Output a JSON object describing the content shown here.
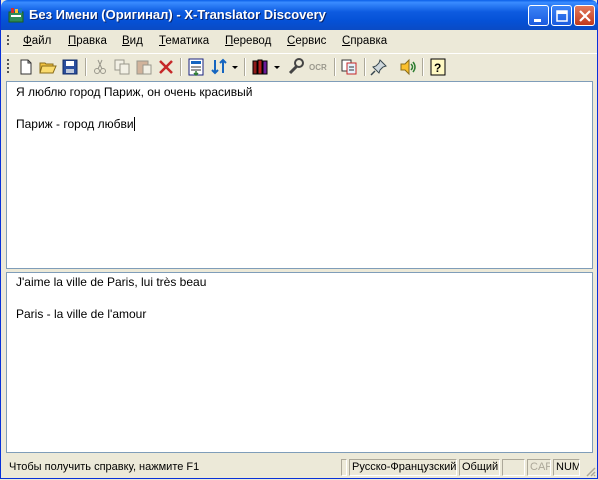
{
  "window": {
    "title": "Без Имени (Оригинал) - X-Translator Discovery",
    "icon": "app-logo-icon",
    "controls": [
      "minimize-icon",
      "maximize-icon",
      "close-icon"
    ]
  },
  "menu": {
    "items": [
      {
        "label": "Файл",
        "mnemonic": "Ф"
      },
      {
        "label": "Правка",
        "mnemonic": "П"
      },
      {
        "label": "Вид",
        "mnemonic": "В"
      },
      {
        "label": "Тематика",
        "mnemonic": "Т"
      },
      {
        "label": "Перевод",
        "mnemonic": "П"
      },
      {
        "label": "Сервис",
        "mnemonic": "С"
      },
      {
        "label": "Справка",
        "mnemonic": "С"
      }
    ]
  },
  "toolbar": {
    "tools": [
      "new-document-icon",
      "open-folder-icon",
      "save-icon",
      "cut-icon",
      "copy-icon",
      "paste-icon",
      "delete-icon",
      "translate-icon",
      "direction-icon",
      "dictionary-icon",
      "settings-wrench-icon",
      "ocr-icon",
      "document-pages-icon",
      "pin-icon",
      "speaker-icon",
      "help-icon"
    ],
    "ocr_label": "OCR"
  },
  "source": {
    "lines": [
      "Я люблю город Париж, он очень красивый",
      "Париж - город любви"
    ]
  },
  "translation": {
    "lines": [
      "J'aime la ville de Paris, lui très beau",
      "Paris - la ville de l'amour"
    ]
  },
  "status": {
    "message": "Чтобы получить справку, нажмите F1",
    "direction": "Русско-Французский",
    "subject": "Общий",
    "cap": "CAP",
    "num": "NUM"
  },
  "colors": {
    "titlebar": "#0A5FE8",
    "face": "#ECE9D8",
    "pane_border": "#7F9DB9"
  }
}
